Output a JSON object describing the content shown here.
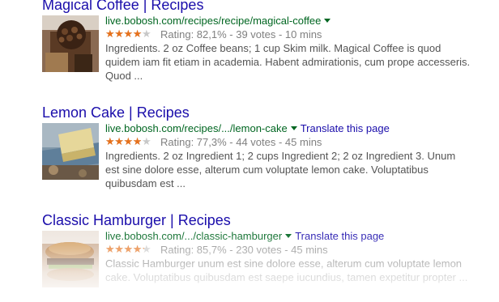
{
  "results": [
    {
      "title": "Magical Coffee | Recipes",
      "url": "live.bobosh.com/recipes/recipe/magical-coffee",
      "translate": "",
      "rating_text": "Rating: 82,1% - 39 votes - 10 mins",
      "rating_fraction": 0.821,
      "snippet": "Ingredients. 2 oz Coffee beans; 1 cup Skim milk. Magical Coffee is quod quidem iam fit etiam in academia. Habent admirationis, cum prope accesseris. Quod ...",
      "thumb_icon": "coffee-grinder-image"
    },
    {
      "title": "Lemon Cake | Recipes",
      "url": "live.bobosh.com/recipes/.../lemon-cake",
      "translate": "Translate this page",
      "rating_text": "Rating: 77,3% - 44 votes - 45 mins",
      "rating_fraction": 0.773,
      "snippet": "Ingredients. 2 oz Ingredient 1; 2 cups Ingredient 2; 2 oz Ingredient 3. Unum est sine dolore esse, alterum cum voluptate lemon cake. Voluptatibus quibusdam est ...",
      "thumb_icon": "lemon-cake-image"
    },
    {
      "title": "Classic Hamburger | Recipes",
      "url": "live.bobosh.com/.../classic-hamburger",
      "translate": "Translate this page",
      "rating_text": "Rating: 85,7% - 230 votes - 45 mins",
      "rating_fraction": 0.857,
      "snippet": "Classic Hamburger unum est sine dolore esse, alterum cum voluptate lemon cake. Voluptatibus quibusdam est saepe iucundius, tamen expetitur propter ...",
      "thumb_icon": "hamburger-image"
    }
  ],
  "colors": {
    "title": "#1a0dab",
    "url": "#006621",
    "star": "#e7711b",
    "snippet": "#545454"
  }
}
